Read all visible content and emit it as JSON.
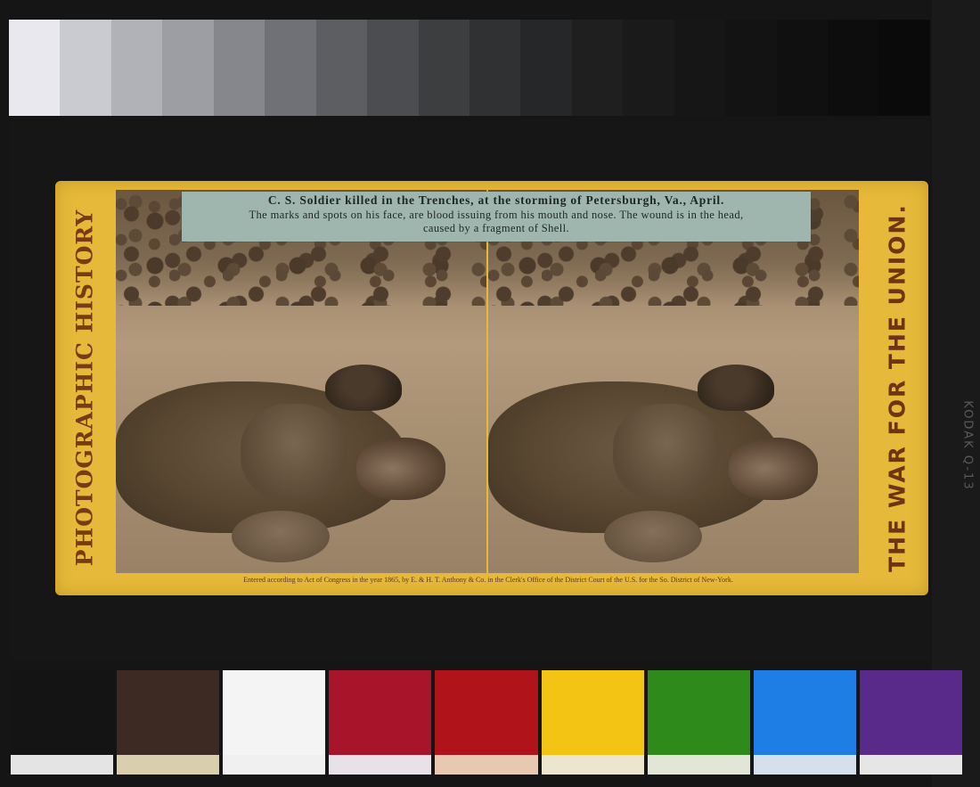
{
  "card": {
    "left_side_text": "PHOTOGRAPHIC HISTORY",
    "right_side_text": "THE WAR FOR THE UNION.",
    "caption": {
      "line1": "C. S. Soldier killed in the Trenches, at the storming of Petersburgh, Va., April.",
      "line2": "The marks and spots on his face, are blood issuing from his mouth and nose.   The wound is in the head,",
      "line3": "caused by a fragment of Shell."
    },
    "copyright": "Entered according to Act of Congress in the year 1865, by E. & H. T. Anthony & Co. in the Clerk's Office of the District Court of the U.S. for the So. District of New-York."
  },
  "scan_edge_text": "KODAK Q-13",
  "colors": {
    "card_yellow": "#e6b93a",
    "caption_label": "#9fb6ae",
    "side_text": "#7a3a12",
    "background": "#151515"
  },
  "gray_scale": [
    "#e8e8ee",
    "#c9cbd1",
    "#b0b2b8",
    "#9c9ea4",
    "#85878c",
    "#6f7176",
    "#5c5e62",
    "#4b4d50",
    "#3c3e40",
    "#303133",
    "#262728",
    "#1f1f20",
    "#1a1a1a",
    "#161616",
    "#131313",
    "#101010",
    "#0d0d0d",
    "#0a0a0a"
  ],
  "color_patches": [
    {
      "main": "#141414",
      "sub": "#e4e4e4"
    },
    {
      "main": "#3d2a22",
      "sub": "#d9cfae"
    },
    {
      "main": "#f4f4f4",
      "sub": "#f0f0f0"
    },
    {
      "main": "#a8142a",
      "sub": "#e8e2e8"
    },
    {
      "main": "#b0141a",
      "sub": "#e6c9b0"
    },
    {
      "main": "#f3c413",
      "sub": "#ece6cf"
    },
    {
      "main": "#2e8a1a",
      "sub": "#e2e6d6"
    },
    {
      "main": "#1e7ee6",
      "sub": "#d6e0ec"
    },
    {
      "main": "#5a2a8a",
      "sub": "#e6e6e6"
    }
  ]
}
